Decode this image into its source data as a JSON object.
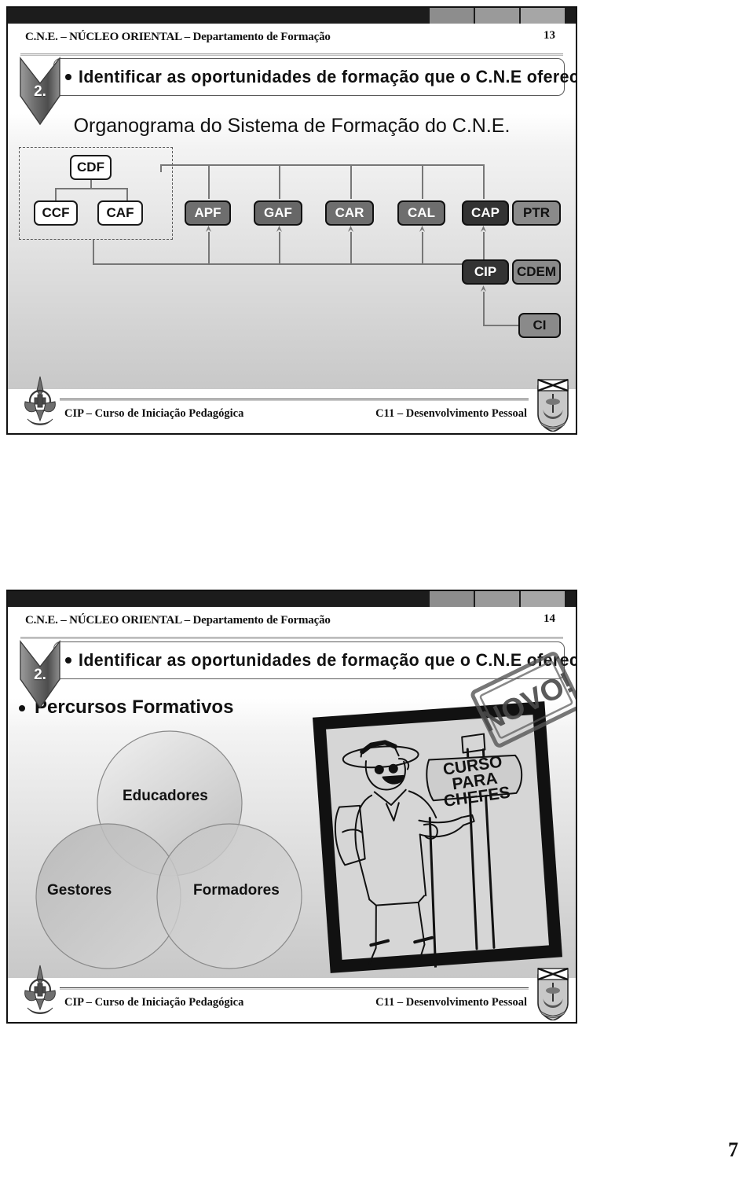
{
  "document": {
    "page_number": "7"
  },
  "slides": [
    {
      "id": "slide-13",
      "header_title": "C.N.E. – NÚCLEO ORIENTAL – Departamento de Formação",
      "slide_number": "13",
      "objective": {
        "marker": "2.",
        "text": "Identificar as oportunidades de formação que o C.N.E oferece."
      },
      "subtitle": "Organograma do Sistema de Formação do C.N.E.",
      "organogram": {
        "nodes": [
          {
            "label": "CDF",
            "style": "white"
          },
          {
            "label": "CCF",
            "style": "white"
          },
          {
            "label": "CAF",
            "style": "white"
          },
          {
            "label": "APF",
            "style": "mid"
          },
          {
            "label": "GAF",
            "style": "mid2"
          },
          {
            "label": "CAR",
            "style": "mid"
          },
          {
            "label": "CAL",
            "style": "mid"
          },
          {
            "label": "CAP",
            "style": "dark"
          },
          {
            "label": "PTR",
            "style": "light"
          },
          {
            "label": "CIP",
            "style": "dark"
          },
          {
            "label": "CDEM",
            "style": "light"
          },
          {
            "label": "CI",
            "style": "light"
          }
        ]
      },
      "footer": {
        "left": "CIP – Curso de Iniciação Pedagógica",
        "right": "C11 – Desenvolvimento Pessoal"
      }
    },
    {
      "id": "slide-14",
      "header_title": "C.N.E. – NÚCLEO ORIENTAL – Departamento de Formação",
      "slide_number": "14",
      "objective": {
        "marker": "2.",
        "text": "Identificar as oportunidades de formação que o C.N.E oferece."
      },
      "bullet": "Percursos Formativos",
      "venn": {
        "circles": [
          {
            "label": "Educadores"
          },
          {
            "label": "Gestores"
          },
          {
            "label": "Formadores"
          }
        ]
      },
      "illustration": {
        "sign_lines": [
          "CURSO",
          "PARA",
          "CHEFES"
        ],
        "stamp_text": "NOVO!"
      },
      "footer": {
        "left": "CIP – Curso de Iniciação Pedagógica",
        "right": "C11 – Desenvolvimento Pessoal"
      }
    }
  ]
}
